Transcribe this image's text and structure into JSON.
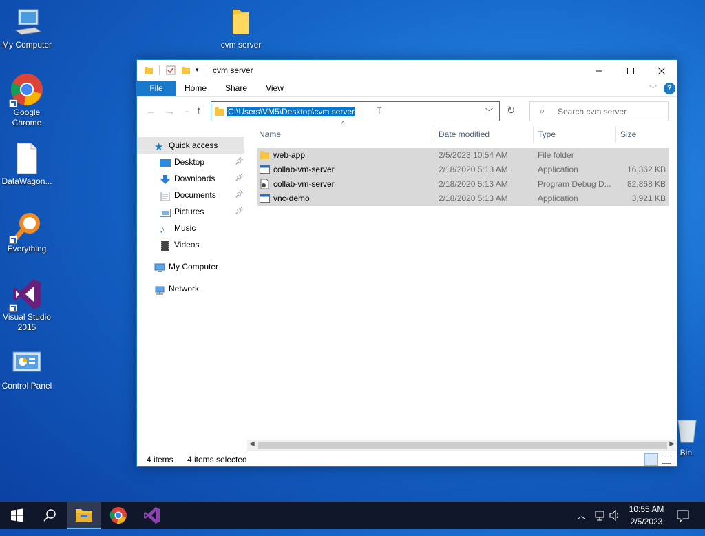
{
  "desktop": {
    "icons": [
      {
        "label": "My Computer"
      },
      {
        "label": "cvm server"
      },
      {
        "label": "Google Chrome"
      },
      {
        "label": "DataWagon..."
      },
      {
        "label": "Everything"
      },
      {
        "label": "Visual Studio 2015"
      },
      {
        "label": "Control Panel"
      },
      {
        "label": "Bin"
      }
    ]
  },
  "window": {
    "title": "cvm server",
    "tabs": [
      "File",
      "Home",
      "Share",
      "View"
    ],
    "address": "C:\\Users\\VM5\\Desktop\\cvm server",
    "search_placeholder": "Search cvm server",
    "nav": {
      "quick_access": "Quick access",
      "items": [
        "Desktop",
        "Downloads",
        "Documents",
        "Pictures",
        "Music",
        "Videos"
      ],
      "my_computer": "My Computer",
      "network": "Network"
    },
    "columns": [
      "Name",
      "Date modified",
      "Type",
      "Size"
    ],
    "files": [
      {
        "name": "web-app",
        "date": "2/5/2023 10:54 AM",
        "type": "File folder",
        "size": "",
        "icon": "folder-icon"
      },
      {
        "name": "collab-vm-server",
        "date": "2/18/2020 5:13 AM",
        "type": "Application",
        "size": "16,362 KB",
        "icon": "application-icon"
      },
      {
        "name": "collab-vm-server",
        "date": "2/18/2020 5:13 AM",
        "type": "Program Debug D...",
        "size": "82,868 KB",
        "icon": "debug-file-icon"
      },
      {
        "name": "vnc-demo",
        "date": "2/18/2020 5:13 AM",
        "type": "Application",
        "size": "3,921 KB",
        "icon": "application-icon"
      }
    ],
    "status": {
      "count": "4 items",
      "selected": "4 items selected"
    }
  },
  "taskbar": {
    "time": "10:55 AM",
    "date": "2/5/2023"
  },
  "colors": {
    "accent": "#1979ca",
    "selection": "#0078d7",
    "row_selected": "#d9d9d9",
    "taskbar": "#10172a"
  }
}
